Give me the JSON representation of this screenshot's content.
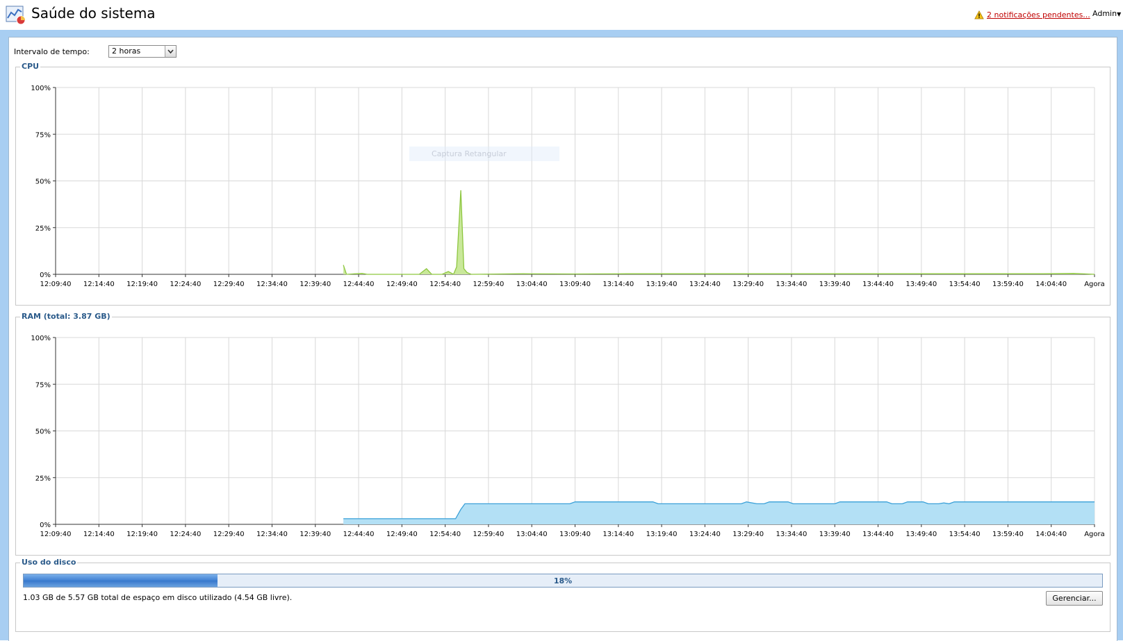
{
  "header": {
    "title": "Saúde do sistema",
    "app_icon": "system-health-icon",
    "notifications_label": "2 notificações pendentes...",
    "warning_icon": "warning-icon",
    "user_menu": "Admin"
  },
  "controls": {
    "interval_label": "Intervalo de tempo:",
    "interval_value": "2 horas"
  },
  "ghost_tooltip": "Captura Retangular",
  "cpu": {
    "legend": "CPU",
    "chart_data": {
      "type": "area",
      "color": "#8dc63f",
      "fill": "#c9e89a",
      "y_ticks": [
        "100%",
        "75%",
        "50%",
        "25%",
        "0%"
      ],
      "ylim": [
        0,
        100
      ],
      "x_ticks": [
        "12:09:40",
        "12:14:40",
        "12:19:40",
        "12:24:40",
        "12:29:40",
        "12:34:40",
        "12:39:40",
        "12:44:40",
        "12:49:40",
        "12:54:40",
        "12:59:40",
        "13:04:40",
        "13:09:40",
        "13:14:40",
        "13:19:40",
        "13:24:40",
        "13:29:40",
        "13:34:40",
        "13:39:40",
        "13:44:40",
        "13:49:40",
        "13:54:40",
        "13:59:40",
        "14:04:40",
        "Agora"
      ],
      "points": [
        [
          27.7,
          5
        ],
        [
          28.0,
          0
        ],
        [
          29.5,
          0.5
        ],
        [
          30,
          0
        ],
        [
          35,
          0
        ],
        [
          35.7,
          3
        ],
        [
          36.2,
          0
        ],
        [
          37.2,
          0
        ],
        [
          37.8,
          1.5
        ],
        [
          38.3,
          0
        ],
        [
          38.6,
          4
        ],
        [
          39.0,
          45
        ],
        [
          39.3,
          3
        ],
        [
          39.6,
          1
        ],
        [
          40,
          0
        ],
        [
          45,
          0.3
        ],
        [
          50,
          0.2
        ],
        [
          55,
          0.3
        ],
        [
          60,
          0.3
        ],
        [
          65,
          0.3
        ],
        [
          70,
          0.3
        ],
        [
          75,
          0.3
        ],
        [
          80,
          0.3
        ],
        [
          85,
          0.3
        ],
        [
          90,
          0.3
        ],
        [
          95,
          0.3
        ],
        [
          98,
          0.5
        ],
        [
          100,
          0
        ]
      ]
    }
  },
  "ram": {
    "legend": "RAM (total: 3.87 GB)",
    "chart_data": {
      "type": "area",
      "color": "#3aa0d8",
      "fill": "#b3e0f5",
      "y_ticks": [
        "100%",
        "75%",
        "50%",
        "25%",
        "0%"
      ],
      "ylim": [
        0,
        100
      ],
      "x_ticks": [
        "12:09:40",
        "12:14:40",
        "12:19:40",
        "12:24:40",
        "12:29:40",
        "12:34:40",
        "12:39:40",
        "12:44:40",
        "12:49:40",
        "12:54:40",
        "12:59:40",
        "13:04:40",
        "13:09:40",
        "13:14:40",
        "13:19:40",
        "13:24:40",
        "13:29:40",
        "13:34:40",
        "13:39:40",
        "13:44:40",
        "13:49:40",
        "13:54:40",
        "13:59:40",
        "14:04:40",
        "Agora"
      ],
      "points": [
        [
          27.7,
          3
        ],
        [
          38.5,
          3
        ],
        [
          39.0,
          8
        ],
        [
          39.4,
          11
        ],
        [
          49.5,
          11
        ],
        [
          50,
          12
        ],
        [
          57.5,
          12
        ],
        [
          58,
          11
        ],
        [
          66,
          11
        ],
        [
          66.5,
          12
        ],
        [
          67.5,
          11
        ],
        [
          68.2,
          11
        ],
        [
          68.7,
          12
        ],
        [
          70.5,
          12
        ],
        [
          71,
          11
        ],
        [
          75,
          11
        ],
        [
          75.5,
          12
        ],
        [
          80,
          12
        ],
        [
          80.5,
          11
        ],
        [
          81.5,
          11
        ],
        [
          82,
          12
        ],
        [
          83.5,
          12
        ],
        [
          84,
          11
        ],
        [
          85,
          11
        ],
        [
          85.5,
          11.5
        ],
        [
          86,
          11
        ],
        [
          86.5,
          12
        ],
        [
          100,
          12
        ]
      ]
    }
  },
  "disk": {
    "legend": "Uso do disco",
    "percent_label": "18%",
    "percent_value": 18,
    "summary": "1.03 GB de 5.57 GB total de espaço em disco utilizado (4.54 GB livre).",
    "manage_label": "Gerenciar..."
  }
}
